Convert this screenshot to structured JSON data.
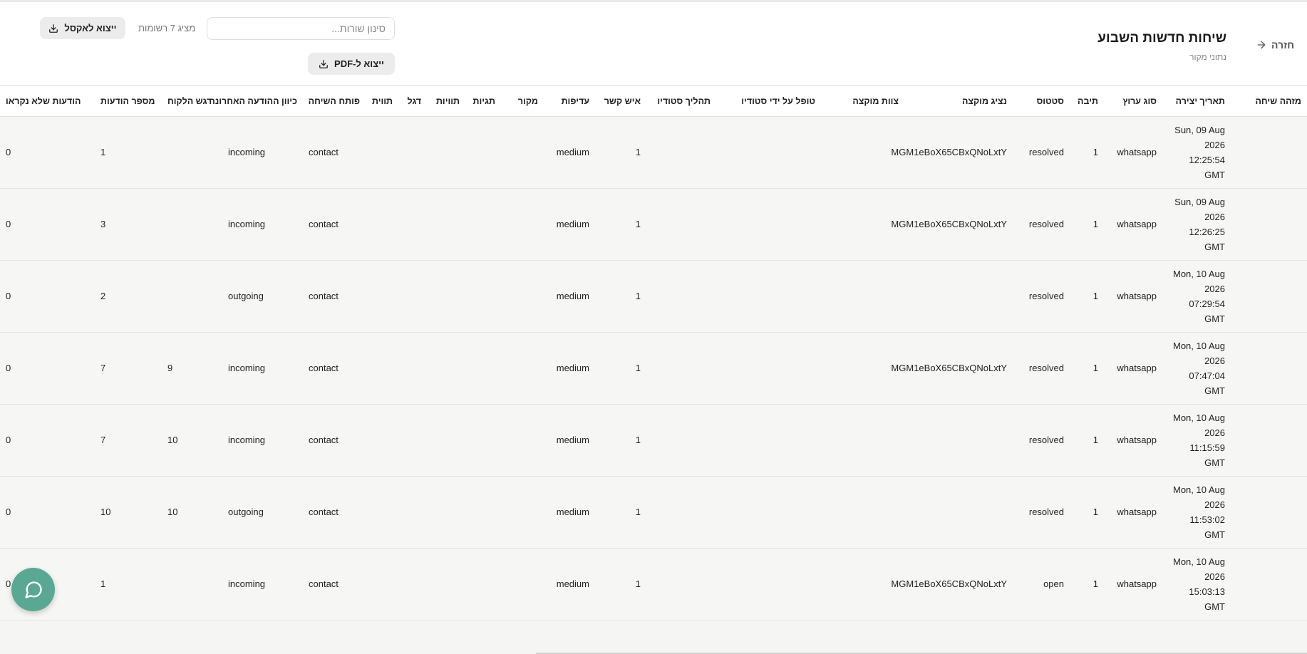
{
  "header": {
    "back_label": "חזרה",
    "title": "שיחות חדשות השבוע",
    "subtitle": "נתוני מקור"
  },
  "toolbar": {
    "search_placeholder": "סינון שורות...",
    "record_count": "מציג 7 רשומות",
    "export_excel_label": "ייצוא לאקסל",
    "export_pdf_label": "ייצוא ל-PDF"
  },
  "icons": {
    "back": "arrow-right-icon",
    "download": "download-icon",
    "chat": "chat-bubble-icon"
  },
  "colors": {
    "fab": "#5aa893",
    "row_bg": "#f6f6f4",
    "header_bg": "#ffffff"
  },
  "table": {
    "columns": [
      "מזהה שיחה",
      "תאריך יצירה",
      "סוג ערוץ",
      "תיבה",
      "סטטוס",
      "נציג מוקצה",
      "צוות מוקצה",
      "טופל על ידי סטודיו",
      "תהליך סטודיו",
      "איש קשר",
      "עדיפות",
      "מקור",
      "תגיות",
      "תוויות",
      "דגל",
      "תווית",
      "פותח השיחה",
      "כיוון ההודעה האחרונה",
      "רגש הלקוח",
      "מספר הודעות",
      "הודעות שלא נקראו"
    ],
    "rows": [
      [
        "",
        "Sun, 09 Aug 2026 12:25:54 GMT",
        "whatsapp",
        "1",
        "resolved",
        "MGM1eBoX65CBxQNoLxtY",
        "",
        "",
        "",
        "1",
        "medium",
        "",
        "",
        "",
        "",
        "",
        "contact",
        "incoming",
        "",
        "1",
        "0"
      ],
      [
        "",
        "Sun, 09 Aug 2026 12:26:25 GMT",
        "whatsapp",
        "1",
        "resolved",
        "MGM1eBoX65CBxQNoLxtY",
        "",
        "",
        "",
        "1",
        "medium",
        "",
        "",
        "",
        "",
        "",
        "contact",
        "incoming",
        "",
        "3",
        "0"
      ],
      [
        "",
        "Mon, 10 Aug 2026 07:29:54 GMT",
        "whatsapp",
        "1",
        "resolved",
        "",
        "",
        "",
        "",
        "1",
        "medium",
        "",
        "",
        "",
        "",
        "",
        "contact",
        "outgoing",
        "",
        "2",
        "0"
      ],
      [
        "",
        "Mon, 10 Aug 2026 07:47:04 GMT",
        "whatsapp",
        "1",
        "resolved",
        "MGM1eBoX65CBxQNoLxtY",
        "",
        "",
        "",
        "1",
        "medium",
        "",
        "",
        "",
        "",
        "",
        "contact",
        "incoming",
        "9",
        "7",
        "0"
      ],
      [
        "",
        "Mon, 10 Aug 2026 11:15:59 GMT",
        "whatsapp",
        "1",
        "resolved",
        "",
        "",
        "",
        "",
        "1",
        "medium",
        "",
        "",
        "",
        "",
        "",
        "contact",
        "incoming",
        "10",
        "7",
        "0"
      ],
      [
        "",
        "Mon, 10 Aug 2026 11:53:02 GMT",
        "whatsapp",
        "1",
        "resolved",
        "",
        "",
        "",
        "",
        "1",
        "medium",
        "",
        "",
        "",
        "",
        "",
        "contact",
        "outgoing",
        "10",
        "10",
        "0"
      ],
      [
        "",
        "Mon, 10 Aug 2026 15:03:13 GMT",
        "whatsapp",
        "1",
        "open",
        "MGM1eBoX65CBxQNoLxtY",
        "",
        "",
        "",
        "1",
        "medium",
        "",
        "",
        "",
        "",
        "",
        "contact",
        "incoming",
        "",
        "1",
        "0"
      ]
    ]
  }
}
